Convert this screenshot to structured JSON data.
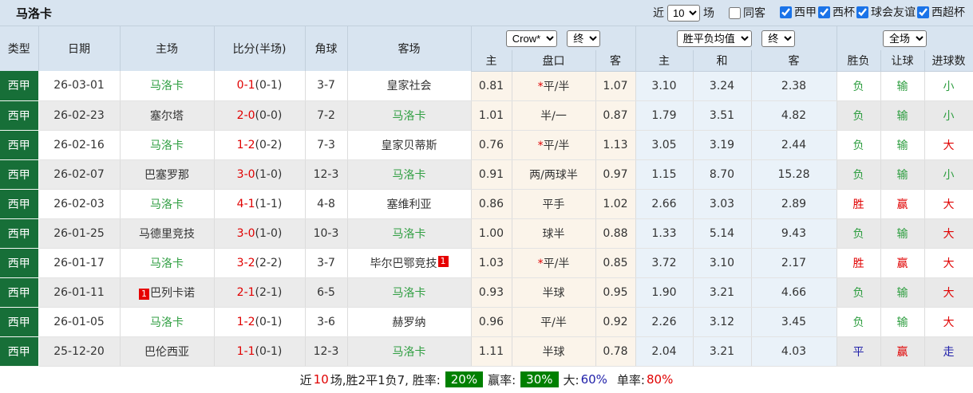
{
  "title": "马洛卡",
  "controls": {
    "recent_label": "近",
    "count_value": "10",
    "matches_label": "场",
    "same_venue": {
      "label": "同客",
      "checked": false
    },
    "competitions": [
      {
        "label": "西甲",
        "checked": true
      },
      {
        "label": "西杯",
        "checked": true
      },
      {
        "label": "球会友谊",
        "checked": true
      },
      {
        "label": "西超杯",
        "checked": true
      }
    ]
  },
  "header": {
    "static_cols": [
      "类型",
      "日期",
      "主场",
      "比分(半场)",
      "角球",
      "客场"
    ],
    "odds_company_select": "Crow*",
    "odds_state_select": "终",
    "avg_select": "胜平负均值",
    "avg_state_select": "终",
    "scope_select": "全场",
    "odds_subcols": [
      "主",
      "盘口",
      "客"
    ],
    "avg_subcols": [
      "主",
      "和",
      "客"
    ],
    "result_subcols": [
      "胜负",
      "让球",
      "进球数"
    ]
  },
  "rows": [
    {
      "league": "西甲",
      "date": "26-03-01",
      "home": {
        "text": "马洛卡",
        "green": true,
        "badge": ""
      },
      "score": {
        "main": "0-1",
        "half": "(0-1)"
      },
      "corners": "3-7",
      "away": {
        "text": "皇家社会",
        "green": false,
        "badge": ""
      },
      "odds": {
        "home": "0.81",
        "star": true,
        "handicap": "平/半",
        "away": "1.07"
      },
      "avg": {
        "home": "3.10",
        "draw": "3.24",
        "away": "2.38"
      },
      "outcome": {
        "text": "负",
        "color": "green"
      },
      "handicap_result": {
        "text": "输",
        "color": "green"
      },
      "goals": {
        "text": "小",
        "color": "green"
      }
    },
    {
      "league": "西甲",
      "date": "26-02-23",
      "home": {
        "text": "塞尔塔",
        "green": false,
        "badge": ""
      },
      "score": {
        "main": "2-0",
        "half": "(0-0)"
      },
      "corners": "7-2",
      "away": {
        "text": "马洛卡",
        "green": true,
        "badge": ""
      },
      "odds": {
        "home": "1.01",
        "star": false,
        "handicap": "半/一",
        "away": "0.87"
      },
      "avg": {
        "home": "1.79",
        "draw": "3.51",
        "away": "4.82"
      },
      "outcome": {
        "text": "负",
        "color": "green"
      },
      "handicap_result": {
        "text": "输",
        "color": "green"
      },
      "goals": {
        "text": "小",
        "color": "green"
      }
    },
    {
      "league": "西甲",
      "date": "26-02-16",
      "home": {
        "text": "马洛卡",
        "green": true,
        "badge": ""
      },
      "score": {
        "main": "1-2",
        "half": "(0-2)"
      },
      "corners": "7-3",
      "away": {
        "text": "皇家贝蒂斯",
        "green": false,
        "badge": ""
      },
      "odds": {
        "home": "0.76",
        "star": true,
        "handicap": "平/半",
        "away": "1.13"
      },
      "avg": {
        "home": "3.05",
        "draw": "3.19",
        "away": "2.44"
      },
      "outcome": {
        "text": "负",
        "color": "green"
      },
      "handicap_result": {
        "text": "输",
        "color": "green"
      },
      "goals": {
        "text": "大",
        "color": "red"
      }
    },
    {
      "league": "西甲",
      "date": "26-02-07",
      "home": {
        "text": "巴塞罗那",
        "green": false,
        "badge": ""
      },
      "score": {
        "main": "3-0",
        "half": "(1-0)"
      },
      "corners": "12-3",
      "away": {
        "text": "马洛卡",
        "green": true,
        "badge": ""
      },
      "odds": {
        "home": "0.91",
        "star": false,
        "handicap": "两/两球半",
        "away": "0.97"
      },
      "avg": {
        "home": "1.15",
        "draw": "8.70",
        "away": "15.28"
      },
      "outcome": {
        "text": "负",
        "color": "green"
      },
      "handicap_result": {
        "text": "输",
        "color": "green"
      },
      "goals": {
        "text": "小",
        "color": "green"
      }
    },
    {
      "league": "西甲",
      "date": "26-02-03",
      "home": {
        "text": "马洛卡",
        "green": true,
        "badge": ""
      },
      "score": {
        "main": "4-1",
        "half": "(1-1)"
      },
      "corners": "4-8",
      "away": {
        "text": "塞维利亚",
        "green": false,
        "badge": ""
      },
      "odds": {
        "home": "0.86",
        "star": false,
        "handicap": "平手",
        "away": "1.02"
      },
      "avg": {
        "home": "2.66",
        "draw": "3.03",
        "away": "2.89"
      },
      "outcome": {
        "text": "胜",
        "color": "red"
      },
      "handicap_result": {
        "text": "赢",
        "color": "red"
      },
      "goals": {
        "text": "大",
        "color": "red"
      }
    },
    {
      "league": "西甲",
      "date": "26-01-25",
      "home": {
        "text": "马德里竞技",
        "green": false,
        "badge": ""
      },
      "score": {
        "main": "3-0",
        "half": "(1-0)"
      },
      "corners": "10-3",
      "away": {
        "text": "马洛卡",
        "green": true,
        "badge": ""
      },
      "odds": {
        "home": "1.00",
        "star": false,
        "handicap": "球半",
        "away": "0.88"
      },
      "avg": {
        "home": "1.33",
        "draw": "5.14",
        "away": "9.43"
      },
      "outcome": {
        "text": "负",
        "color": "green"
      },
      "handicap_result": {
        "text": "输",
        "color": "green"
      },
      "goals": {
        "text": "大",
        "color": "red"
      }
    },
    {
      "league": "西甲",
      "date": "26-01-17",
      "home": {
        "text": "马洛卡",
        "green": true,
        "badge": ""
      },
      "score": {
        "main": "3-2",
        "half": "(2-2)"
      },
      "corners": "3-7",
      "away": {
        "text": "毕尔巴鄂竞技",
        "green": false,
        "badge": "1"
      },
      "odds": {
        "home": "1.03",
        "star": true,
        "handicap": "平/半",
        "away": "0.85"
      },
      "avg": {
        "home": "3.72",
        "draw": "3.10",
        "away": "2.17"
      },
      "outcome": {
        "text": "胜",
        "color": "red"
      },
      "handicap_result": {
        "text": "赢",
        "color": "red"
      },
      "goals": {
        "text": "大",
        "color": "red"
      }
    },
    {
      "league": "西甲",
      "date": "26-01-11",
      "home": {
        "text": "巴列卡诺",
        "green": false,
        "badge": "1"
      },
      "score": {
        "main": "2-1",
        "half": "(2-1)"
      },
      "corners": "6-5",
      "away": {
        "text": "马洛卡",
        "green": true,
        "badge": ""
      },
      "odds": {
        "home": "0.93",
        "star": false,
        "handicap": "半球",
        "away": "0.95"
      },
      "avg": {
        "home": "1.90",
        "draw": "3.21",
        "away": "4.66"
      },
      "outcome": {
        "text": "负",
        "color": "green"
      },
      "handicap_result": {
        "text": "输",
        "color": "green"
      },
      "goals": {
        "text": "大",
        "color": "red"
      }
    },
    {
      "league": "西甲",
      "date": "26-01-05",
      "home": {
        "text": "马洛卡",
        "green": true,
        "badge": ""
      },
      "score": {
        "main": "1-2",
        "half": "(0-1)"
      },
      "corners": "3-6",
      "away": {
        "text": "赫罗纳",
        "green": false,
        "badge": ""
      },
      "odds": {
        "home": "0.96",
        "star": false,
        "handicap": "平/半",
        "away": "0.92"
      },
      "avg": {
        "home": "2.26",
        "draw": "3.12",
        "away": "3.45"
      },
      "outcome": {
        "text": "负",
        "color": "green"
      },
      "handicap_result": {
        "text": "输",
        "color": "green"
      },
      "goals": {
        "text": "大",
        "color": "red"
      }
    },
    {
      "league": "西甲",
      "date": "25-12-20",
      "home": {
        "text": "巴伦西亚",
        "green": false,
        "badge": ""
      },
      "score": {
        "main": "1-1",
        "half": "(0-1)"
      },
      "corners": "12-3",
      "away": {
        "text": "马洛卡",
        "green": true,
        "badge": ""
      },
      "odds": {
        "home": "1.11",
        "star": false,
        "handicap": "半球",
        "away": "0.78"
      },
      "avg": {
        "home": "2.04",
        "draw": "3.21",
        "away": "4.03"
      },
      "outcome": {
        "text": "平",
        "color": "blue"
      },
      "handicap_result": {
        "text": "赢",
        "color": "red"
      },
      "goals": {
        "text": "走",
        "color": "blue"
      }
    }
  ],
  "footer": {
    "recent_label": "近",
    "recent_count": "10",
    "summary": "场,胜2平1负7, 胜率:",
    "win_rate": "20%",
    "win_odds_label": "赢率:",
    "win_odds_rate": "30%",
    "big_label": "大:",
    "big_rate": "60%",
    "single_label": "单率:",
    "single_rate": "80%"
  },
  "colors": {
    "league_cell_bg": "#176f38",
    "team_green": "#2f9e41",
    "score_red": "#e00000",
    "neutral_blue": "#2222aa",
    "odds_col_bg": "#fbf4ea",
    "avg_col_bg": "#eaf2f9",
    "header_bg": "#d8e4f0",
    "row_alt_bg": "#ebebeb",
    "rate_badge_bg": "#008000"
  }
}
